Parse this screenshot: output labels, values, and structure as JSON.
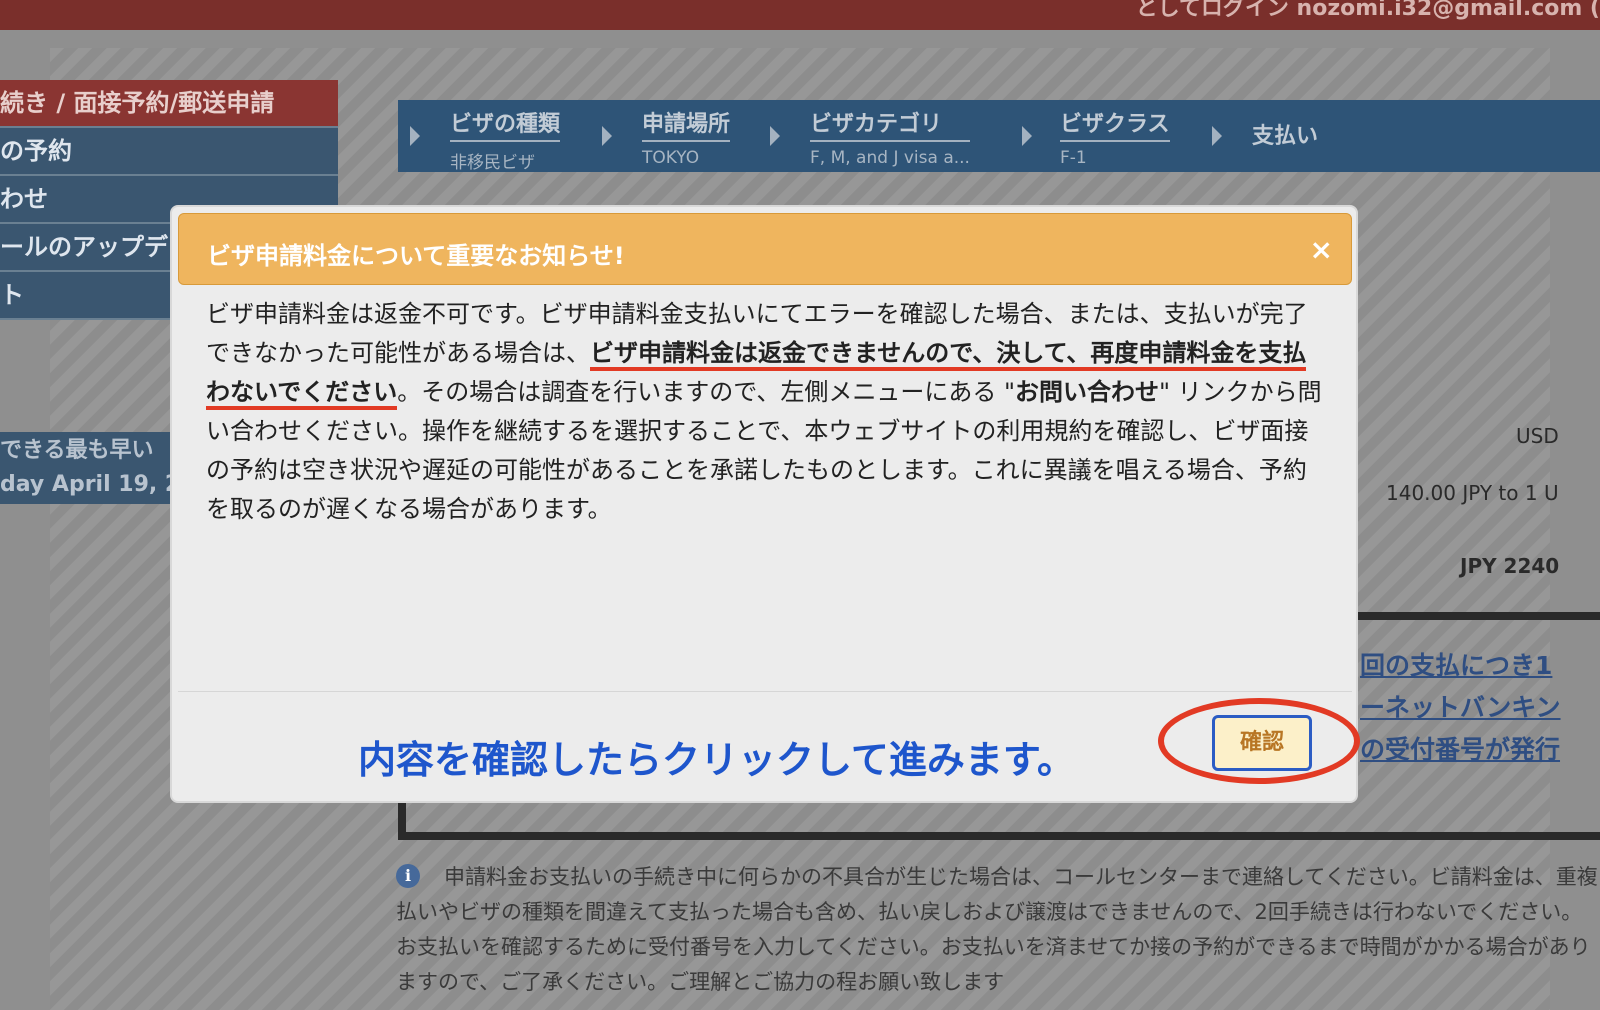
{
  "header": {
    "login_text": "としてログイン  nozomi.i32@gmail.com ("
  },
  "sidebar": {
    "items": [
      {
        "label": "続き / 面接予約/郵送申請",
        "active": true
      },
      {
        "label": "の予約"
      },
      {
        "label": "わせ"
      },
      {
        "label": "ールのアップデ"
      },
      {
        "label": "ト"
      }
    ],
    "note_line1": "できる最も早い",
    "note_line2": "day April 19, 2"
  },
  "steps": [
    {
      "title": "ビザの種類",
      "sub": "非移民ビザ"
    },
    {
      "title": "申請場所",
      "sub": "TOKYO"
    },
    {
      "title": "ビザカテゴリ",
      "sub": "F, M, and J visa a..."
    },
    {
      "title": "ビザクラス",
      "sub": "F-1"
    },
    {
      "title": "支払い",
      "sub": ""
    }
  ],
  "background": {
    "usd": "USD",
    "rate": "140.00 JPY to 1 U",
    "total": "JPY 2240",
    "link_lines": [
      "回の支払につき1",
      "ーネットバンキン",
      "の受付番号が発行"
    ],
    "notice": "申請料金お支払いの手続き中に何らかの不具合が生じた場合は、コールセンターまで連絡してください。ビ請料金は、重複払いやビザの種類を間違えて支払った場合も含め、払い戻しおよび譲渡はできませんので、2回手続きは行わないでください。お支払いを確認するために受付番号を入力してください。お支払いを済ませてか接の予約ができるまで時間がかかる場合がありますので、ご了承ください。ご理解とご協力の程お願い致します"
  },
  "modal": {
    "title": "ビザ申請料金について重要なお知らせ!",
    "close": "×",
    "body_part1": "ビザ申請料金は返金不可です。ビザ申請料金支払いにてエラーを確認した場合、または、支払いが完了できなかった可能性がある場合は、",
    "body_emph": "ビザ申請料金は返金できませんので、決して、再度申請料金を支払わないでください",
    "body_part2": "。その場合は調査を行いますので、左側メニューにある \"",
    "body_link": "お問い合わせ",
    "body_part3": "\" リンクから問い合わせください。操作を継続するを選択することで、本ウェブサイトの利用規約を確認し、ビザ面接の予約は空き状況や遅延の可能性があることを承諾したものとします。これに異議を唱える場合、予約を取るのが遅くなる場合があります。",
    "confirm_label": "確認"
  },
  "annotation": {
    "hint": "内容を確認したらクリックして進みます。",
    "color": "#1e56cc",
    "circle_color": "#e23a24"
  }
}
